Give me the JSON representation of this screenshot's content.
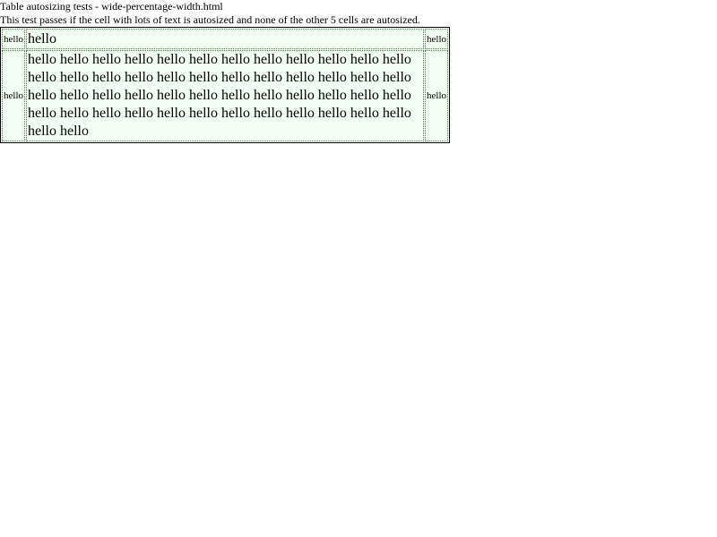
{
  "page": {
    "title": "Table autosizing tests - wide-percentage-width.html",
    "description": "This test passes if the cell with lots of text is autosized and none of the other 5 cells are autosized."
  },
  "table": {
    "row1": {
      "left": "hello",
      "center": "hello",
      "right": "hello"
    },
    "row2": {
      "left": "hello",
      "center": "hello hello hello hello hello hello hello hello hello hello hello hello hello hello hello hello hello hello hello hello hello hello hello hello hello hello hello hello hello hello hello hello hello hello hello hello hello hello hello hello hello hello hello hello hello hello hello hello hello hello",
      "right": "hello"
    }
  },
  "colors": {
    "cell_background": "#f2fff2",
    "cell_border": "#4a7a4a",
    "table_border": "#000000"
  }
}
